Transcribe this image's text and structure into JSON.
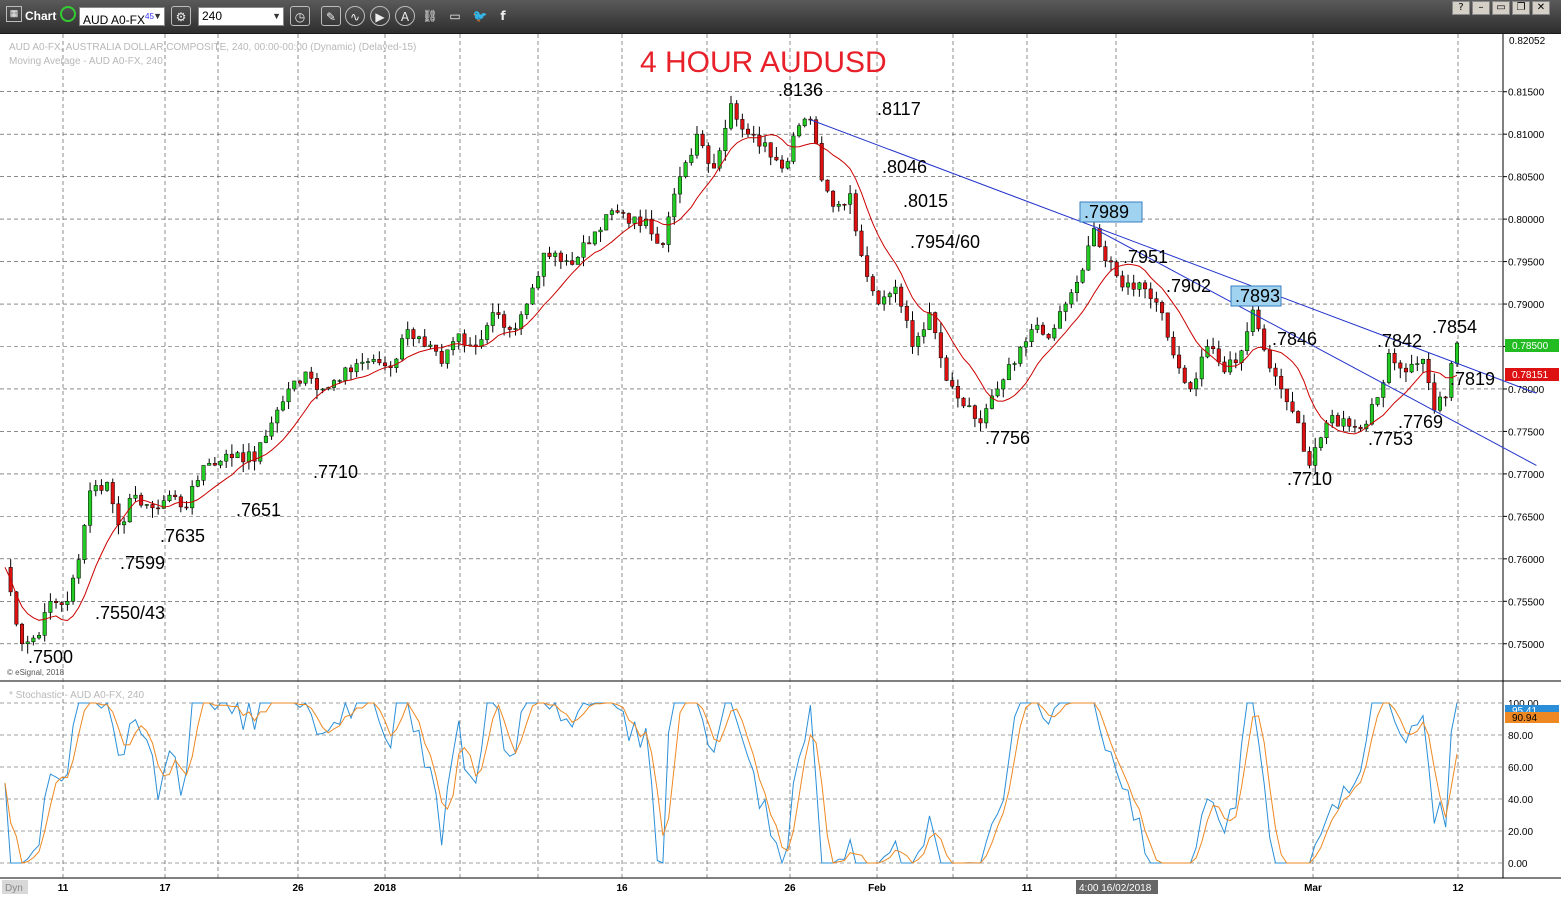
{
  "toolbar": {
    "chart_label": "Chart",
    "symbol": "AUD A0-FX",
    "symbol_superscript": "45",
    "interval": "240",
    "icons": [
      "settings-icon",
      "clock-icon",
      "draw-icon",
      "line-icon",
      "play-icon",
      "alert-icon",
      "link-icon",
      "chat-icon",
      "twitter-icon",
      "facebook-icon"
    ]
  },
  "window_controls": [
    "help",
    "minimize",
    "maximize",
    "restore",
    "close"
  ],
  "chart": {
    "title": "4 HOUR AUDUSD",
    "title_color": "#e8202a",
    "header_line1": "AUD A0-FX, AUSTRALIA DOLLAR COMPOSITE, 240, 00:00-00:00 (Dynamic) (Delayed-15)",
    "header_line2": "Moving Average - AUD A0-FX, 240",
    "copyright": "© eSignal, 2018",
    "stoch_header": "* Stochastic - AUD A0-FX, 240",
    "dyn_label": "Dyn",
    "crosshair_label": "4:00 16/02/2018",
    "price_top_label": "0.82052",
    "current_price": "0.78500",
    "ma_price": "0.78151",
    "stoch_k": "95.41",
    "stoch_d": "90.94",
    "x_labels": [
      "11",
      "17",
      "26",
      "2018",
      "16",
      "26",
      "Feb",
      "11",
      "",
      "Mar",
      "12"
    ],
    "annotations": [
      ".8136",
      ".8117",
      ".8046",
      ".8015",
      ".7954/60",
      ".7951",
      ".7902",
      ".7846",
      ".7842",
      ".7854",
      ".7819",
      ".7769",
      ".7753",
      ".7710",
      ".7756",
      ".7710",
      ".7651",
      ".7635",
      ".7599",
      ".7550/43",
      ".7500"
    ],
    "boxed_annotations": [
      ".7989",
      ".7893"
    ]
  },
  "chart_data": {
    "type": "candlestick",
    "title": "4 HOUR AUDUSD",
    "ylim": [
      0.7475,
      0.8205
    ],
    "y_ticks": [
      "0.81500",
      "0.81000",
      "0.80500",
      "0.80000",
      "0.79500",
      "0.79000",
      "0.78500",
      "0.78000",
      "0.77500",
      "0.77000",
      "0.76500",
      "0.76000",
      "0.75500",
      "0.75000"
    ],
    "stoch_ticks": [
      "100.00",
      "80.00",
      "60.00",
      "40.00",
      "20.00",
      "0.00"
    ],
    "pivots": [
      {
        "x": 0,
        "y": 0.759
      },
      {
        "x": 3,
        "y": 0.75
      },
      {
        "x": 6,
        "y": 0.751
      },
      {
        "x": 8,
        "y": 0.755
      },
      {
        "x": 11,
        "y": 0.755
      },
      {
        "x": 13,
        "y": 0.7599
      },
      {
        "x": 15,
        "y": 0.768
      },
      {
        "x": 18,
        "y": 0.769
      },
      {
        "x": 20,
        "y": 0.764
      },
      {
        "x": 23,
        "y": 0.7675
      },
      {
        "x": 26,
        "y": 0.766
      },
      {
        "x": 29,
        "y": 0.7675
      },
      {
        "x": 32,
        "y": 0.766
      },
      {
        "x": 35,
        "y": 0.771
      },
      {
        "x": 38,
        "y": 0.7715
      },
      {
        "x": 41,
        "y": 0.7725
      },
      {
        "x": 44,
        "y": 0.7715
      },
      {
        "x": 47,
        "y": 0.776
      },
      {
        "x": 50,
        "y": 0.78
      },
      {
        "x": 53,
        "y": 0.782
      },
      {
        "x": 56,
        "y": 0.78
      },
      {
        "x": 59,
        "y": 0.781
      },
      {
        "x": 62,
        "y": 0.783
      },
      {
        "x": 65,
        "y": 0.7835
      },
      {
        "x": 68,
        "y": 0.7825
      },
      {
        "x": 71,
        "y": 0.787
      },
      {
        "x": 74,
        "y": 0.785
      },
      {
        "x": 77,
        "y": 0.783
      },
      {
        "x": 80,
        "y": 0.7865
      },
      {
        "x": 83,
        "y": 0.785
      },
      {
        "x": 86,
        "y": 0.789
      },
      {
        "x": 89,
        "y": 0.787
      },
      {
        "x": 92,
        "y": 0.79
      },
      {
        "x": 95,
        "y": 0.796
      },
      {
        "x": 98,
        "y": 0.795
      },
      {
        "x": 101,
        "y": 0.7955
      },
      {
        "x": 104,
        "y": 0.7985
      },
      {
        "x": 107,
        "y": 0.801
      },
      {
        "x": 110,
        "y": 0.7995
      },
      {
        "x": 113,
        "y": 0.8
      },
      {
        "x": 116,
        "y": 0.797
      },
      {
        "x": 119,
        "y": 0.805
      },
      {
        "x": 122,
        "y": 0.81
      },
      {
        "x": 125,
        "y": 0.806
      },
      {
        "x": 128,
        "y": 0.8136
      },
      {
        "x": 131,
        "y": 0.81
      },
      {
        "x": 134,
        "y": 0.809
      },
      {
        "x": 137,
        "y": 0.806
      },
      {
        "x": 140,
        "y": 0.811
      },
      {
        "x": 142,
        "y": 0.8117
      },
      {
        "x": 144,
        "y": 0.8046
      },
      {
        "x": 146,
        "y": 0.8015
      },
      {
        "x": 149,
        "y": 0.803
      },
      {
        "x": 151,
        "y": 0.7957
      },
      {
        "x": 154,
        "y": 0.79
      },
      {
        "x": 157,
        "y": 0.792
      },
      {
        "x": 160,
        "y": 0.785
      },
      {
        "x": 163,
        "y": 0.789
      },
      {
        "x": 166,
        "y": 0.781
      },
      {
        "x": 169,
        "y": 0.778
      },
      {
        "x": 172,
        "y": 0.776
      },
      {
        "x": 175,
        "y": 0.78
      },
      {
        "x": 178,
        "y": 0.783
      },
      {
        "x": 181,
        "y": 0.787
      },
      {
        "x": 184,
        "y": 0.786
      },
      {
        "x": 187,
        "y": 0.79
      },
      {
        "x": 190,
        "y": 0.794
      },
      {
        "x": 192,
        "y": 0.7989
      },
      {
        "x": 194,
        "y": 0.7951
      },
      {
        "x": 197,
        "y": 0.792
      },
      {
        "x": 200,
        "y": 0.7925
      },
      {
        "x": 203,
        "y": 0.7902
      },
      {
        "x": 206,
        "y": 0.784
      },
      {
        "x": 209,
        "y": 0.78
      },
      {
        "x": 212,
        "y": 0.785
      },
      {
        "x": 215,
        "y": 0.782
      },
      {
        "x": 218,
        "y": 0.7845
      },
      {
        "x": 220,
        "y": 0.7893
      },
      {
        "x": 222,
        "y": 0.7846
      },
      {
        "x": 225,
        "y": 0.78
      },
      {
        "x": 228,
        "y": 0.776
      },
      {
        "x": 230,
        "y": 0.771
      },
      {
        "x": 233,
        "y": 0.776
      },
      {
        "x": 236,
        "y": 0.7765
      },
      {
        "x": 239,
        "y": 0.7753
      },
      {
        "x": 242,
        "y": 0.779
      },
      {
        "x": 244,
        "y": 0.7842
      },
      {
        "x": 247,
        "y": 0.782
      },
      {
        "x": 250,
        "y": 0.7835
      },
      {
        "x": 252,
        "y": 0.7775
      },
      {
        "x": 254,
        "y": 0.779
      },
      {
        "x": 256,
        "y": 0.7854
      }
    ],
    "trendlines": [
      {
        "from": {
          "x": 142,
          "y": 0.8117
        },
        "to": {
          "x": 270,
          "y": 0.7795
        }
      },
      {
        "from": {
          "x": 192,
          "y": 0.7989
        },
        "to": {
          "x": 270,
          "y": 0.771
        }
      }
    ]
  }
}
